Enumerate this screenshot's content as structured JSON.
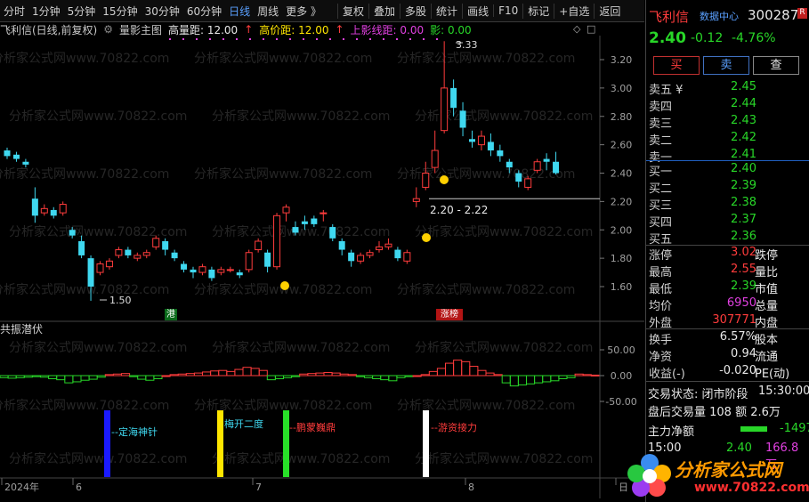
{
  "toolbar": {
    "periods": [
      "分时",
      "1分钟",
      "5分钟",
      "15分钟",
      "30分钟",
      "60分钟",
      "日线",
      "周线",
      "更多 》"
    ],
    "active_period": "日线",
    "tools": [
      "复权",
      "叠加",
      "多股",
      "统计",
      "画线",
      "F10",
      "标记",
      "+自选",
      "返回"
    ]
  },
  "info": {
    "stock_title": "飞利信(日线,前复权)",
    "indicator_name": "量影主图",
    "vol_label": "高量距: 12.00",
    "price_label": "高价距: 12.00",
    "shadow_label": "上影线距: 0.00",
    "ying_label": "影: 0.00"
  },
  "chart_labels": {
    "high_mark": "3.33",
    "low_mark": "1.50",
    "range_mark": "2.20 - 2.22",
    "tag_gang": "港",
    "tag_zhangting": "涨榜"
  },
  "sub_panel": {
    "title": "共振潜伏",
    "signals": [
      "--定海神针",
      "梅开二度",
      "--鹏蒙巍鼎",
      "--游资接力"
    ]
  },
  "price_axis": [
    "3.20",
    "3.00",
    "2.80",
    "2.60",
    "2.40",
    "2.20",
    "2.00",
    "1.80",
    "1.60"
  ],
  "sub_axis": [
    "50.00",
    "0.00",
    "-50.00"
  ],
  "date_axis": [
    "2024年",
    "6",
    "7",
    "8",
    "日"
  ],
  "watermark": "分析家公式网www.70822.com",
  "quote": {
    "name": "飞利信",
    "data_center": "数据中心",
    "code": "300287",
    "price": "2.40",
    "change": "-0.12",
    "change_pct": "-4.76%",
    "buy_btn": "买",
    "sell_btn": "卖",
    "query_btn": "查",
    "asks": [
      {
        "label": "卖五 ¥",
        "price": "2.45"
      },
      {
        "label": "卖四",
        "price": "2.44"
      },
      {
        "label": "卖三",
        "price": "2.43"
      },
      {
        "label": "卖二",
        "price": "2.42"
      },
      {
        "label": "卖一",
        "price": "2.41"
      }
    ],
    "bids": [
      {
        "label": "买一",
        "price": "2.40"
      },
      {
        "label": "买二",
        "price": "2.39"
      },
      {
        "label": "买三",
        "price": "2.38"
      },
      {
        "label": "买四",
        "price": "2.37"
      },
      {
        "label": "买五",
        "price": "2.36"
      }
    ],
    "stats": [
      {
        "l": "涨停",
        "v": "3.02",
        "r": "跌停"
      },
      {
        "l": "最高",
        "v": "2.55",
        "r": "量比"
      },
      {
        "l": "最低",
        "v": "2.39",
        "r": "市值"
      },
      {
        "l": "均价",
        "v": "6950",
        "r": "总量"
      },
      {
        "l": "外盘",
        "v": "307771",
        "r": "内盘"
      }
    ],
    "stats2": [
      {
        "l": "换手",
        "v": "6.57%",
        "r": "股本"
      },
      {
        "l": "净资",
        "v": "0.94",
        "r": "流通"
      },
      {
        "l": "收益(-)",
        "v": "-0.020",
        "r": "PE(动)"
      }
    ],
    "status_label": "交易状态: 闭市阶段",
    "status_time": "15:30:00",
    "after_label": "盘后交易量 108 额 2.6万",
    "main_flow_label": "主力净额",
    "main_flow_val": "-1497",
    "last_time": "15:00",
    "last_price": "2.40",
    "last_vol": "166.8万"
  },
  "logo": {
    "text": "分析家公式网",
    "url": "www.70822.com"
  },
  "colors": {
    "up": "#ff3c3c",
    "down": "#3fd8f0",
    "accent": "#5aa0ff"
  }
}
